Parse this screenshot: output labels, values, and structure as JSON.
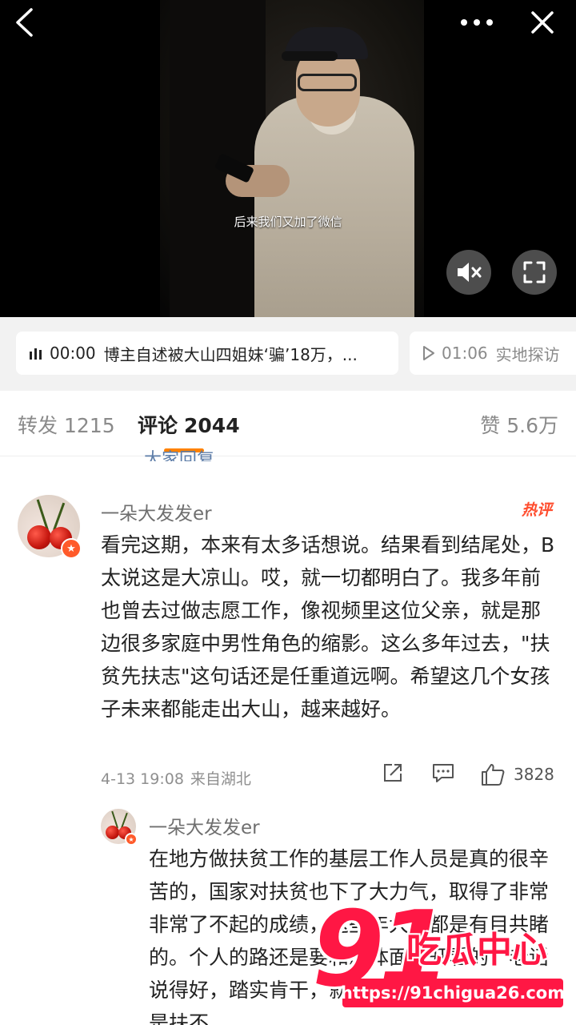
{
  "video": {
    "subtitle": "后来我们又加了微信",
    "icons": {
      "back": "chevron-left-icon",
      "more": "more-dots-icon",
      "close": "close-icon",
      "mute": "speaker-muted-icon",
      "fullscreen": "fullscreen-icon"
    }
  },
  "playlist": [
    {
      "time": "00:00",
      "title": "博主自述被大山四姐妹‘骗’18万，..."
    },
    {
      "time": "01:06",
      "title": "实地探访"
    }
  ],
  "tabs": {
    "repost": {
      "label": "转发",
      "count": "1215"
    },
    "comment": {
      "label": "评论",
      "count": "2044"
    },
    "like": {
      "label": "赞",
      "count": "5.6万"
    }
  },
  "previous_comment_fragment": "大家回复",
  "comment": {
    "username": "一朵大发发er",
    "hot_badge": "热评",
    "text": "看完这期，本来有太多话想说。结果看到结尾处，B太说这是大凉山。哎，就一切都明白了。我多年前也曾去过做志愿工作，像视频里这位父亲，就是那边很多家庭中男性角色的缩影。这么多年过去，\"扶贫先扶志\"这句话还是任重道远啊。希望这几个女孩子未来都能走出大山，越来越好。",
    "date": "4-13 19:08",
    "location": "来自湖北",
    "likes": "3828"
  },
  "reply": {
    "username": "一朵大发发er",
    "text": "在地方做扶贫工作的基层工作人员是真的很辛苦的，国家对扶贫也下了大力气，取得了非常非常了不起的成绩，这些年大家都是有目共睹的。个人的路还是要和总体面分开看的，老话说得好，踏实肯干，就有活路，就怕有些人就是扶不"
  },
  "watermark": {
    "big": "91",
    "name": "吃瓜中心",
    "url": "https://91chigua26.com"
  },
  "colors": {
    "accent": "#ff8200",
    "hot": "#ff4d2e",
    "watermark": "#ff1744"
  }
}
